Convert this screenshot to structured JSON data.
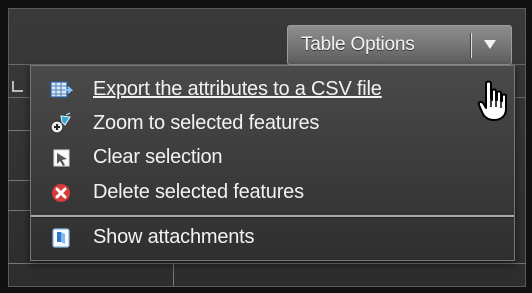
{
  "table_options": {
    "label": "Table Options"
  },
  "menu": {
    "items": [
      {
        "label": "Export the attributes to a CSV file",
        "icon": "csv-export-icon"
      },
      {
        "label": "Zoom to selected features",
        "icon": "zoom-selection-icon"
      },
      {
        "label": "Clear selection",
        "icon": "clear-selection-icon"
      },
      {
        "label": "Delete selected features",
        "icon": "delete-icon"
      },
      {
        "label": "Show attachments",
        "icon": "attachments-icon"
      }
    ]
  },
  "colors": {
    "accent": "#ffffff",
    "delete": "#d83b3b",
    "panel": "#2d2d2d"
  }
}
